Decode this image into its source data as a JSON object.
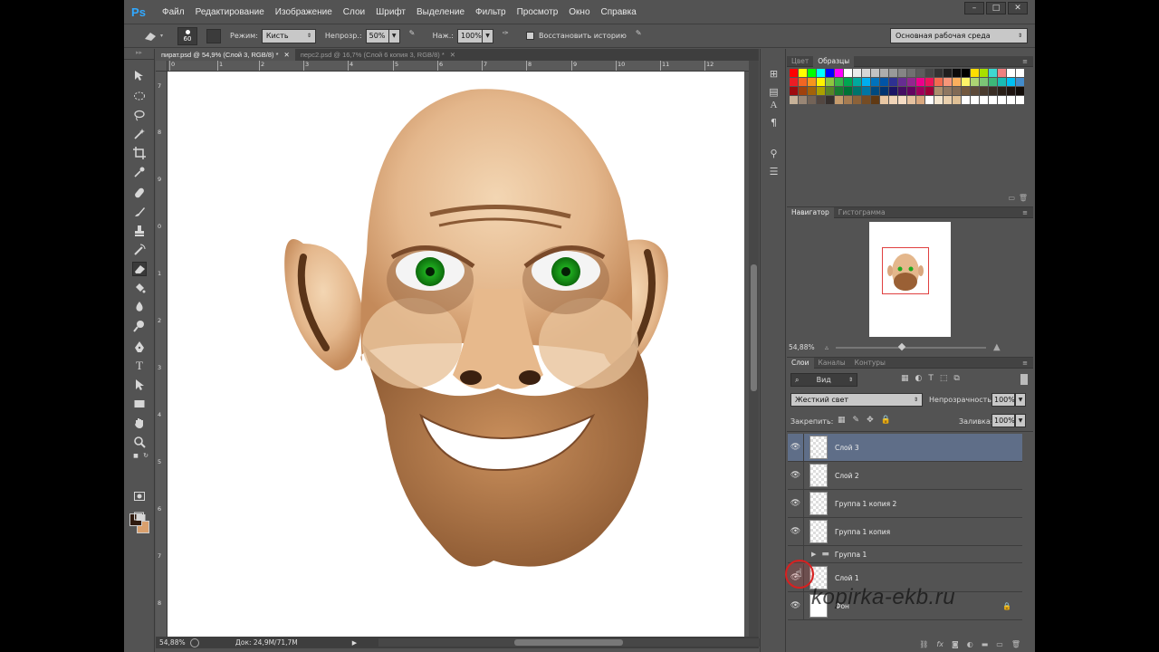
{
  "menubar": {
    "logo": "Ps",
    "items": [
      "Файл",
      "Редактирование",
      "Изображение",
      "Слои",
      "Шрифт",
      "Выделение",
      "Фильтр",
      "Просмотр",
      "Окно",
      "Справка"
    ]
  },
  "options": {
    "brush_size": "60",
    "mode_label": "Режим:",
    "mode_value": "Кисть",
    "opacity_label": "Непрозр.:",
    "opacity_value": "50%",
    "pressure_label": "Наж.:",
    "pressure_value": "100%",
    "restore_history_label": "Восстановить историю",
    "workspace": "Основная рабочая среда"
  },
  "documents": [
    {
      "title": "пират.psd @ 54,9% (Слой 3, RGB/8) *",
      "active": true
    },
    {
      "title": "перс2.psd @ 16,7% (Слой 6 копия 3, RGB/8) *",
      "active": false
    }
  ],
  "ruler_top": [
    "0",
    "1",
    "2",
    "3",
    "4",
    "5",
    "6",
    "7",
    "8",
    "9",
    "10",
    "11",
    "12",
    "13",
    "14",
    "15"
  ],
  "ruler_left": [
    "7",
    "8",
    "9",
    "0",
    "1",
    "2",
    "3",
    "4",
    "5",
    "6",
    "7",
    "8",
    "9",
    "0"
  ],
  "status": {
    "zoom": "54,88%",
    "doc_info": "Док: 24,9M/71,7M"
  },
  "color_panel": {
    "tabs": [
      "Цвет",
      "Образцы"
    ],
    "swatch_rows": [
      [
        "#ff0000",
        "#ffff00",
        "#00ff00",
        "#00ffff",
        "#0000ff",
        "#ff00ff",
        "#ffffff",
        "#ebebeb",
        "#d6d6d6",
        "#c2c2c2",
        "#adadad",
        "#999999",
        "#858585",
        "#707070",
        "#5c5c5c",
        "#474747",
        "#333333",
        "#1f1f1f",
        "#0a0a0a",
        "#000000",
        "#ffde00",
        "#a7e000",
        "#3ed8d0",
        "#f08080",
        "#ffffff",
        "#ffffff"
      ],
      [
        "#ed1c24",
        "#f26522",
        "#f7941d",
        "#fff200",
        "#8dc63f",
        "#39b54a",
        "#00a651",
        "#00a99d",
        "#00aeef",
        "#0072bc",
        "#0054a6",
        "#2e3192",
        "#662d91",
        "#92278f",
        "#ec008c",
        "#ed145b",
        "#f26c4f",
        "#f69679",
        "#fbaf5d",
        "#fff568",
        "#acd373",
        "#7cc576",
        "#3cb878",
        "#1abbb4",
        "#00bff3",
        "#438ccb"
      ],
      [
        "#9e0b0f",
        "#a0410d",
        "#a3620a",
        "#aba000",
        "#598527",
        "#197b30",
        "#007236",
        "#00746b",
        "#0076a3",
        "#004a80",
        "#003471",
        "#1b1464",
        "#440e62",
        "#630460",
        "#9e005d",
        "#9e0039",
        "#ac8f6d",
        "#8f7761",
        "#816a55",
        "#73593f",
        "#5d4a3a",
        "#4b3b2e",
        "#3a2d24",
        "#2a1f18",
        "#1f1410",
        "#120c08"
      ],
      [
        "#c7b299",
        "#998675",
        "#736357",
        "#534741",
        "#37302d",
        "#c69c6d",
        "#a67c52",
        "#8c6239",
        "#754c24",
        "#603913",
        "#e8c7a3",
        "#f0d4b8",
        "#f5dcc4",
        "#e6c2a0",
        "#d9a77e",
        "#ffffff",
        "#f4e6d0",
        "#ead0ae",
        "#dfc096",
        "#ffffff",
        "#ffffff",
        "#ffffff",
        "#ffffff",
        "#ffffff",
        "#ffffff",
        "#ffffff"
      ]
    ]
  },
  "navigator": {
    "tabs": [
      "Навигатор",
      "Гистограмма"
    ],
    "zoom": "54,88%"
  },
  "layers": {
    "tabs": [
      "Слои",
      "Каналы",
      "Контуры"
    ],
    "filter": "Вид",
    "blend_mode": "Жесткий свет",
    "opacity_label": "Непрозрачность:",
    "opacity_value": "100%",
    "lock_label": "Закрепить:",
    "fill_label": "Заливка:",
    "fill_value": "100%",
    "items": [
      {
        "name": "Слой 3",
        "selected": true
      },
      {
        "name": "Слой 2",
        "selected": false
      },
      {
        "name": "Группа 1 копия 2",
        "selected": false
      },
      {
        "name": "Группа 1 копия",
        "selected": false
      },
      {
        "name": "Группа 1",
        "selected": false,
        "group": true
      },
      {
        "name": "Слой 1",
        "selected": false
      },
      {
        "name": "Фон",
        "selected": false,
        "locked": true
      }
    ]
  },
  "watermark": "kopirka-ekb.ru"
}
